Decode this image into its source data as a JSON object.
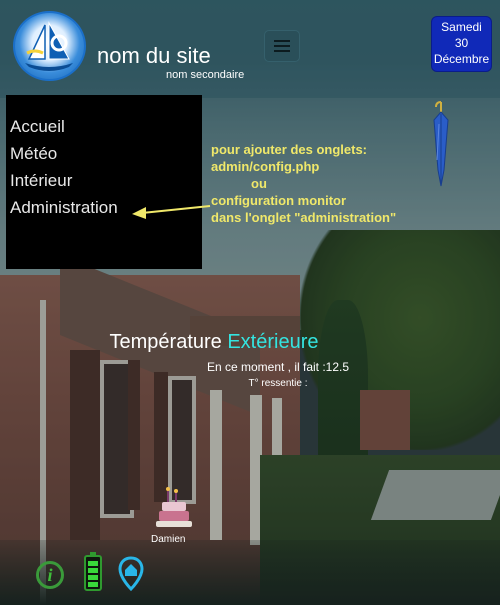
{
  "header": {
    "site_name": "nom du site",
    "site_subtitle": "nom secondaire",
    "menu_icon": "hamburger-menu-icon",
    "logo": "sailboat-logo"
  },
  "date": {
    "weekday": "Samedi",
    "day": "30",
    "month": "Décembre"
  },
  "nav": {
    "items": [
      {
        "label": "Accueil"
      },
      {
        "label": "Météo"
      },
      {
        "label": "Intérieur"
      },
      {
        "label": "Administration"
      }
    ]
  },
  "annotation": {
    "lines": [
      "pour ajouter des onglets:",
      "admin/config.php",
      "ou",
      "configuration monitor",
      "dans l'onglet \"administration\""
    ],
    "color": "#f0e86a"
  },
  "weather": {
    "title_part1": "Température",
    "title_part2": "Extérieure",
    "now_text": "En ce moment , il fait :12.5",
    "felt_text": "T° ressentie :",
    "accent_color": "#34e4e0",
    "umbrella_icon": "umbrella-icon"
  },
  "birthday": {
    "name": "Damien",
    "icon": "birthday-cake-icon"
  },
  "status": {
    "info_icon": "info-icon",
    "battery_icon": "battery-icon",
    "location_icon": "home-location-pin-icon",
    "info_glyph": "i"
  }
}
